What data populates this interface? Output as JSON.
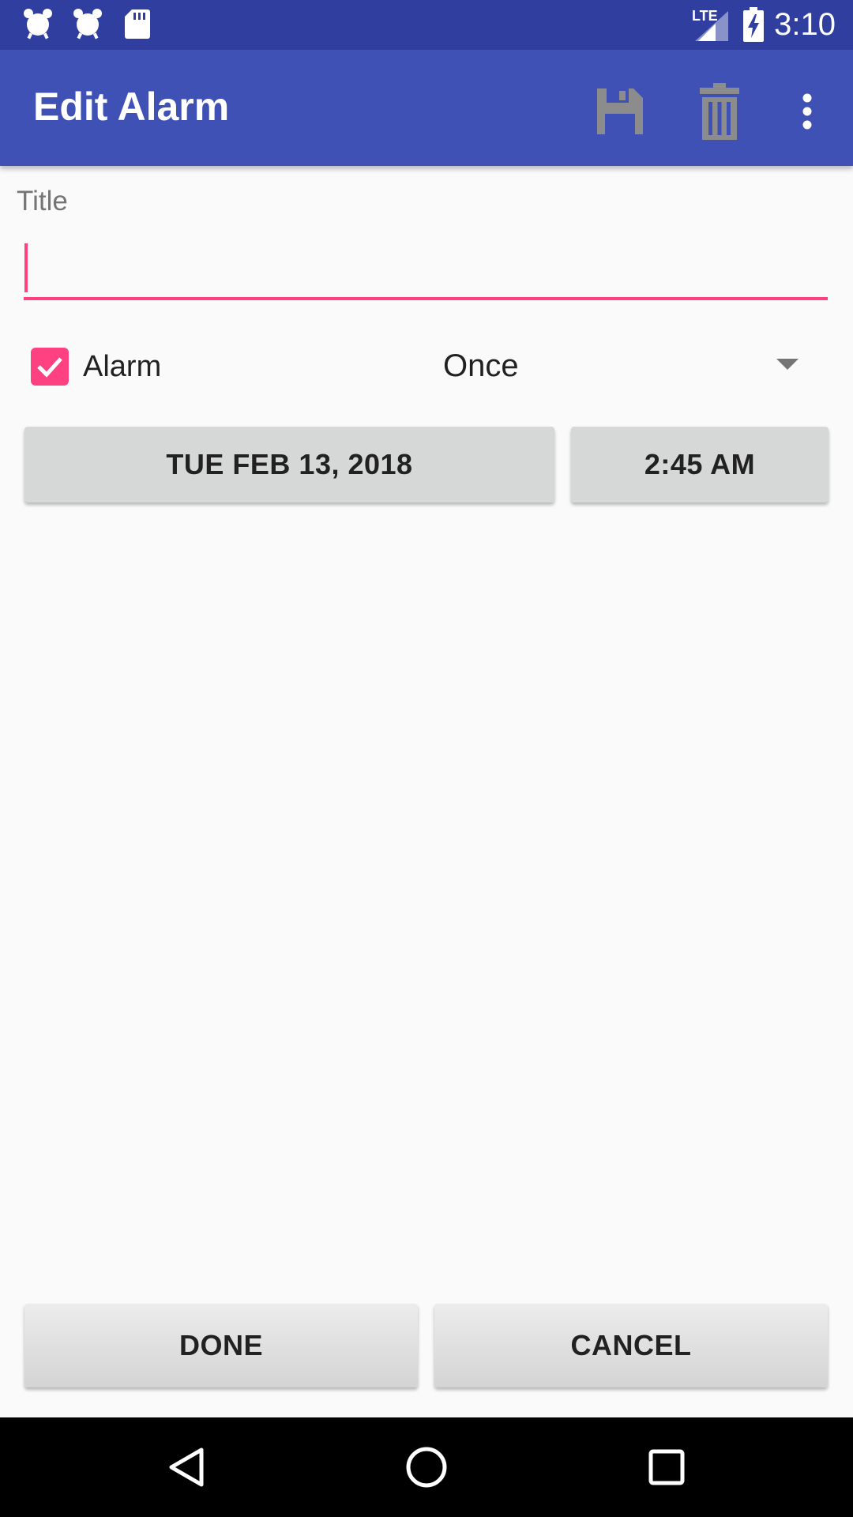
{
  "status_bar": {
    "time": "3:10",
    "network": "LTE",
    "left_icons": [
      "alarm-clock-icon",
      "alarm-clock-icon",
      "sd-card-icon"
    ],
    "right_icons": [
      "signal-icon",
      "battery-charging-icon"
    ]
  },
  "app_bar": {
    "title": "Edit Alarm",
    "actions": [
      "save-icon",
      "delete-icon",
      "overflow-menu-icon"
    ]
  },
  "form": {
    "title_label": "Title",
    "title_value": "",
    "alarm_label": "Alarm",
    "alarm_checked": true,
    "repeat_value": "Once",
    "date_button": "TUE FEB 13, 2018",
    "time_button": "2:45 AM"
  },
  "footer": {
    "done_label": "DONE",
    "cancel_label": "CANCEL"
  },
  "nav_bar": {
    "buttons": [
      "back-icon",
      "home-icon",
      "recents-icon"
    ]
  },
  "colors": {
    "status_bar": "#303f9f",
    "app_bar": "#3f51b5",
    "accent": "#ff4081",
    "button": "#d6d7d7",
    "background": "#fafafa"
  }
}
